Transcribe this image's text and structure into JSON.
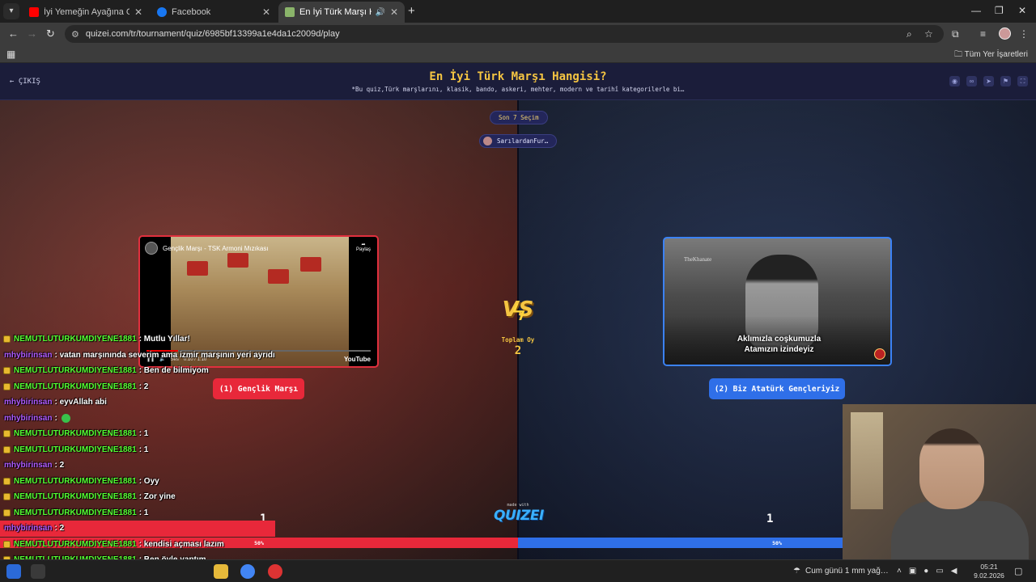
{
  "browser": {
    "tabs": [
      {
        "title": "İyi Yemeğin Ayağına Gidilir #9 |",
        "favicon_color": "#ff0000",
        "active": false
      },
      {
        "title": "Facebook",
        "favicon_color": "#1877f2",
        "active": false
      },
      {
        "title": "En İyi Türk Marşı Hangisi?",
        "favicon_color": "#8ab46a",
        "active": true
      }
    ],
    "url": "quizei.com/tr/tournament/quiz/6985bf13399a1e4da1c2009d/play",
    "bookmarks_all": "Tüm Yer İşaretleri"
  },
  "quiz": {
    "exit_label": "ÇIKIŞ",
    "title": "En İyi Türk Marşı Hangisi?",
    "description": "*Bu quiz,Türk marşlarını, klasik, bando, askeri, mehter, modern ve tarihî kategorilerle bi…",
    "round_label": "Son 7 Seçim",
    "user_label": "SarılardanFur…",
    "total_label": "Toplam Oy",
    "total_votes": "2",
    "vs_text": "VS",
    "made_with": "made with",
    "brand": "QUIZEI",
    "left": {
      "choice": "(1) Gençlik Marşı",
      "votes": "1",
      "percent_label": "50%",
      "percent": 50,
      "video": {
        "title": "Gençlik Marşı - TSK Armoni Mızıkası",
        "share": "Paylaş",
        "time": "0:10 / 1:10",
        "volume_label": "Ses",
        "brand": "YouTube",
        "progress": 0.14
      }
    },
    "right": {
      "choice": "(2) Biz Atatürk Gençleriyiz",
      "votes": "1",
      "percent_label": "50%",
      "percent": 50,
      "image": {
        "watermark": "TheKhanate",
        "caption_line1": "Aklımızla coşkumuzla",
        "caption_line2": "Atamızın izindeyiz"
      }
    }
  },
  "chat": [
    {
      "user": "NEMUTLUTURKUMDIYENE1881",
      "msg": ": Mutlu Yıllar!",
      "color": "green"
    },
    {
      "user": "mhybirinsan",
      "msg": ": vatan marşınında severim ama izmir marşının yeri ayrıdır",
      "color": "purple"
    },
    {
      "user": "NEMUTLUTURKUMDIYENE1881",
      "msg": ": Ben de bilmiyom",
      "color": "green"
    },
    {
      "user": "NEMUTLUTURKUMDIYENE1881",
      "msg": ": 2",
      "color": "green"
    },
    {
      "user": "mhybirinsan",
      "msg": ": eyvAllah abi",
      "color": "purple"
    },
    {
      "user": "mhybirinsan",
      "msg": ":",
      "color": "purple",
      "emoji": true
    },
    {
      "user": "NEMUTLUTURKUMDIYENE1881",
      "msg": ": 1",
      "color": "green"
    },
    {
      "user": "NEMUTLUTURKUMDIYENE1881",
      "msg": ": 1",
      "color": "green"
    },
    {
      "user": "mhybirinsan",
      "msg": ": 2",
      "color": "purple"
    },
    {
      "user": "NEMUTLUTURKUMDIYENE1881",
      "msg": ": Oyy",
      "color": "green"
    },
    {
      "user": "NEMUTLUTURKUMDIYENE1881",
      "msg": ": Zor yine",
      "color": "green"
    },
    {
      "user": "NEMUTLUTURKUMDIYENE1881",
      "msg": ": 1",
      "color": "green"
    },
    {
      "user": "mhybirinsan",
      "msg": ": 2",
      "color": "purple",
      "highlight": true
    },
    {
      "user": "NEMUTLUTURKUMDIYENE1881",
      "msg": ": kendisi açması lazım",
      "color": "green"
    },
    {
      "user": "NEMUTLUTURKUMDIYENE1881",
      "msg": ": Ben öyle yaptım",
      "color": "green"
    }
  ],
  "taskbar": {
    "weather": "Cum günü 1 mm yağ…",
    "time": "05:21",
    "date": "9.02.2026"
  },
  "colors": {
    "accent_gold": "#f5c542",
    "left_red": "#e8283a",
    "right_blue": "#2f6fe8",
    "chat_green": "#55ff33",
    "chat_purple": "#b05bff"
  }
}
